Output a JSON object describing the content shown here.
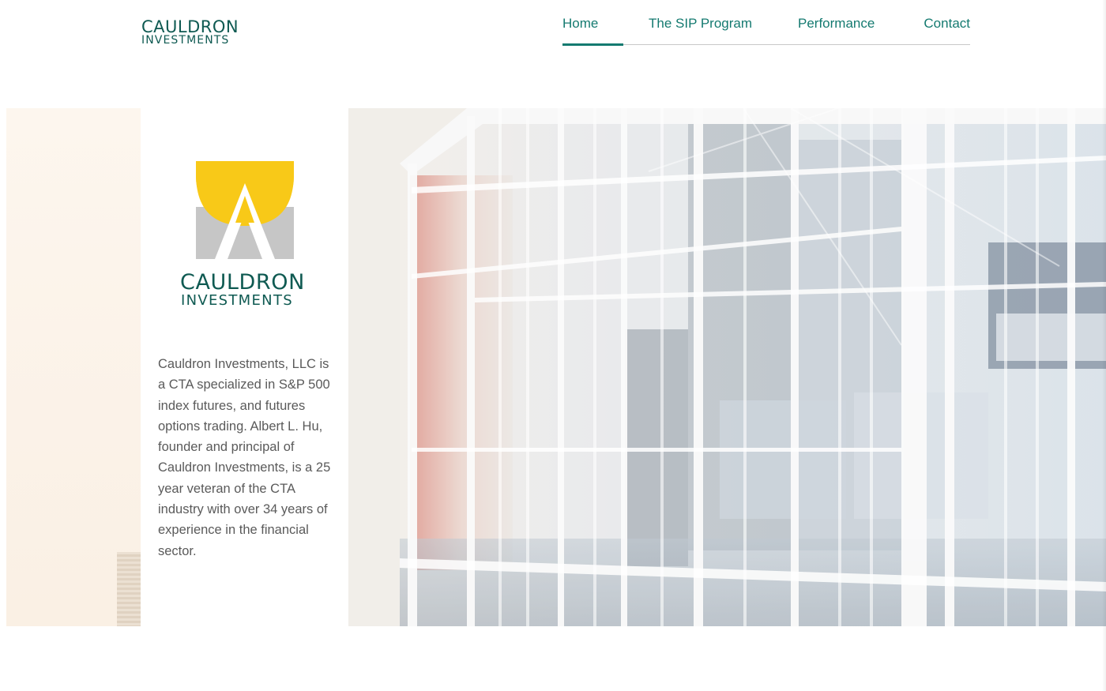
{
  "header": {
    "logo_line1": "CAULDRON",
    "logo_line2": "INVESTMENTS"
  },
  "nav": {
    "items": [
      {
        "label": "Home",
        "active": true
      },
      {
        "label": "The SIP Program",
        "active": false
      },
      {
        "label": "Performance",
        "active": false
      },
      {
        "label": "Contact",
        "active": false
      }
    ]
  },
  "panel": {
    "logo_line1": "CAULDRON",
    "logo_line2": "INVESTMENTS",
    "description": "Cauldron Investments, LLC is a CTA specialized in S&P 500 index futures, and futures options trading. Albert L. Hu, founder and principal of Cauldron Investments, is a 25 year veteran of the CTA industry with over 34 years of experience in the financial sector."
  },
  "colors": {
    "brand_green": "#0f5a52",
    "nav_teal": "#147a70",
    "logo_yellow": "#f8c918",
    "logo_gray": "#c6c6c6"
  }
}
